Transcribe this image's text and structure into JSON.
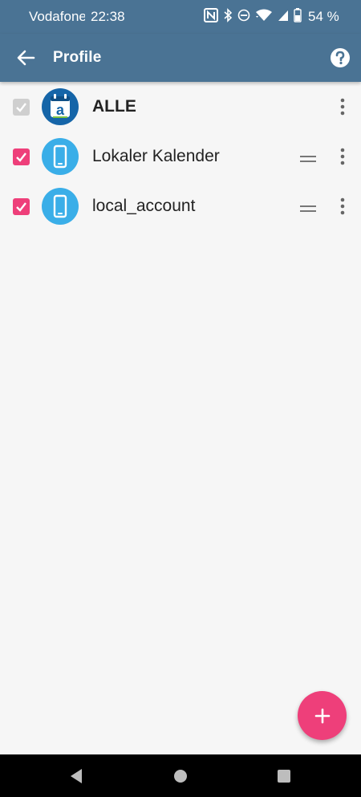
{
  "status_bar": {
    "carrier": "Vodafone",
    "time": "22:38",
    "battery": "54 %",
    "icons": [
      "nfc-icon",
      "bluetooth-icon",
      "dnd-icon",
      "wifi-icon",
      "signal-icon",
      "battery-icon"
    ]
  },
  "appbar": {
    "title": "Profile"
  },
  "profiles": [
    {
      "label": "ALLE",
      "checked": true,
      "disabled": true,
      "icon": "app-logo-icon"
    },
    {
      "label": "Lokaler Kalender",
      "checked": true,
      "disabled": false,
      "icon": "phone-icon"
    },
    {
      "label": "local_account",
      "checked": true,
      "disabled": false,
      "icon": "phone-icon"
    }
  ],
  "colors": {
    "primary": "#4a7394",
    "accent": "#ee3f7a",
    "avatar_phone": "#3aaee8",
    "avatar_app": "#1565a8"
  }
}
